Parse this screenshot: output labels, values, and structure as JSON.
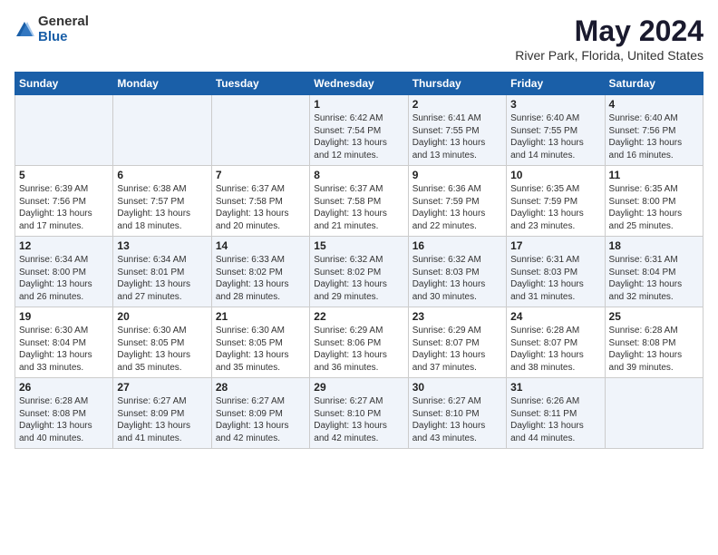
{
  "header": {
    "logo_general": "General",
    "logo_blue": "Blue",
    "main_title": "May 2024",
    "sub_title": "River Park, Florida, United States"
  },
  "weekdays": [
    "Sunday",
    "Monday",
    "Tuesday",
    "Wednesday",
    "Thursday",
    "Friday",
    "Saturday"
  ],
  "weeks": [
    [
      {
        "day": "",
        "info": ""
      },
      {
        "day": "",
        "info": ""
      },
      {
        "day": "",
        "info": ""
      },
      {
        "day": "1",
        "info": "Sunrise: 6:42 AM\nSunset: 7:54 PM\nDaylight: 13 hours\nand 12 minutes."
      },
      {
        "day": "2",
        "info": "Sunrise: 6:41 AM\nSunset: 7:55 PM\nDaylight: 13 hours\nand 13 minutes."
      },
      {
        "day": "3",
        "info": "Sunrise: 6:40 AM\nSunset: 7:55 PM\nDaylight: 13 hours\nand 14 minutes."
      },
      {
        "day": "4",
        "info": "Sunrise: 6:40 AM\nSunset: 7:56 PM\nDaylight: 13 hours\nand 16 minutes."
      }
    ],
    [
      {
        "day": "5",
        "info": "Sunrise: 6:39 AM\nSunset: 7:56 PM\nDaylight: 13 hours\nand 17 minutes."
      },
      {
        "day": "6",
        "info": "Sunrise: 6:38 AM\nSunset: 7:57 PM\nDaylight: 13 hours\nand 18 minutes."
      },
      {
        "day": "7",
        "info": "Sunrise: 6:37 AM\nSunset: 7:58 PM\nDaylight: 13 hours\nand 20 minutes."
      },
      {
        "day": "8",
        "info": "Sunrise: 6:37 AM\nSunset: 7:58 PM\nDaylight: 13 hours\nand 21 minutes."
      },
      {
        "day": "9",
        "info": "Sunrise: 6:36 AM\nSunset: 7:59 PM\nDaylight: 13 hours\nand 22 minutes."
      },
      {
        "day": "10",
        "info": "Sunrise: 6:35 AM\nSunset: 7:59 PM\nDaylight: 13 hours\nand 23 minutes."
      },
      {
        "day": "11",
        "info": "Sunrise: 6:35 AM\nSunset: 8:00 PM\nDaylight: 13 hours\nand 25 minutes."
      }
    ],
    [
      {
        "day": "12",
        "info": "Sunrise: 6:34 AM\nSunset: 8:00 PM\nDaylight: 13 hours\nand 26 minutes."
      },
      {
        "day": "13",
        "info": "Sunrise: 6:34 AM\nSunset: 8:01 PM\nDaylight: 13 hours\nand 27 minutes."
      },
      {
        "day": "14",
        "info": "Sunrise: 6:33 AM\nSunset: 8:02 PM\nDaylight: 13 hours\nand 28 minutes."
      },
      {
        "day": "15",
        "info": "Sunrise: 6:32 AM\nSunset: 8:02 PM\nDaylight: 13 hours\nand 29 minutes."
      },
      {
        "day": "16",
        "info": "Sunrise: 6:32 AM\nSunset: 8:03 PM\nDaylight: 13 hours\nand 30 minutes."
      },
      {
        "day": "17",
        "info": "Sunrise: 6:31 AM\nSunset: 8:03 PM\nDaylight: 13 hours\nand 31 minutes."
      },
      {
        "day": "18",
        "info": "Sunrise: 6:31 AM\nSunset: 8:04 PM\nDaylight: 13 hours\nand 32 minutes."
      }
    ],
    [
      {
        "day": "19",
        "info": "Sunrise: 6:30 AM\nSunset: 8:04 PM\nDaylight: 13 hours\nand 33 minutes."
      },
      {
        "day": "20",
        "info": "Sunrise: 6:30 AM\nSunset: 8:05 PM\nDaylight: 13 hours\nand 35 minutes."
      },
      {
        "day": "21",
        "info": "Sunrise: 6:30 AM\nSunset: 8:05 PM\nDaylight: 13 hours\nand 35 minutes."
      },
      {
        "day": "22",
        "info": "Sunrise: 6:29 AM\nSunset: 8:06 PM\nDaylight: 13 hours\nand 36 minutes."
      },
      {
        "day": "23",
        "info": "Sunrise: 6:29 AM\nSunset: 8:07 PM\nDaylight: 13 hours\nand 37 minutes."
      },
      {
        "day": "24",
        "info": "Sunrise: 6:28 AM\nSunset: 8:07 PM\nDaylight: 13 hours\nand 38 minutes."
      },
      {
        "day": "25",
        "info": "Sunrise: 6:28 AM\nSunset: 8:08 PM\nDaylight: 13 hours\nand 39 minutes."
      }
    ],
    [
      {
        "day": "26",
        "info": "Sunrise: 6:28 AM\nSunset: 8:08 PM\nDaylight: 13 hours\nand 40 minutes."
      },
      {
        "day": "27",
        "info": "Sunrise: 6:27 AM\nSunset: 8:09 PM\nDaylight: 13 hours\nand 41 minutes."
      },
      {
        "day": "28",
        "info": "Sunrise: 6:27 AM\nSunset: 8:09 PM\nDaylight: 13 hours\nand 42 minutes."
      },
      {
        "day": "29",
        "info": "Sunrise: 6:27 AM\nSunset: 8:10 PM\nDaylight: 13 hours\nand 42 minutes."
      },
      {
        "day": "30",
        "info": "Sunrise: 6:27 AM\nSunset: 8:10 PM\nDaylight: 13 hours\nand 43 minutes."
      },
      {
        "day": "31",
        "info": "Sunrise: 6:26 AM\nSunset: 8:11 PM\nDaylight: 13 hours\nand 44 minutes."
      },
      {
        "day": "",
        "info": ""
      }
    ]
  ]
}
